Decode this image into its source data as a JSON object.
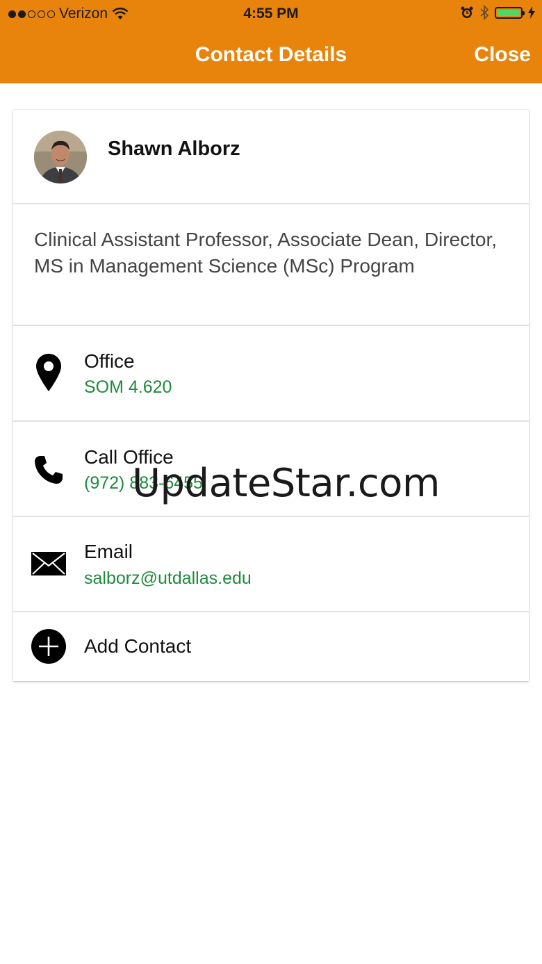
{
  "status_bar": {
    "carrier": "Verizon",
    "time": "4:55 PM"
  },
  "nav": {
    "title": "Contact Details",
    "close_label": "Close"
  },
  "contact": {
    "name": "Shawn Alborz",
    "position": "Clinical Assistant Professor, Associate Dean, Director, MS in Management Science (MSc) Program",
    "office": {
      "label": "Office",
      "value": "SOM 4.620",
      "icon": "location-pin-icon"
    },
    "phone": {
      "label": "Call Office",
      "value": "(972) 883-6455",
      "icon": "phone-icon"
    },
    "email": {
      "label": "Email",
      "value": "salborz@utdallas.edu",
      "icon": "envelope-icon"
    },
    "add": {
      "label": "Add Contact",
      "icon": "add-circle-icon"
    }
  },
  "watermark": "UpdateStar.com",
  "colors": {
    "header": "#e8840b",
    "link_green": "#1e8a3c",
    "battery": "#4cd964"
  }
}
